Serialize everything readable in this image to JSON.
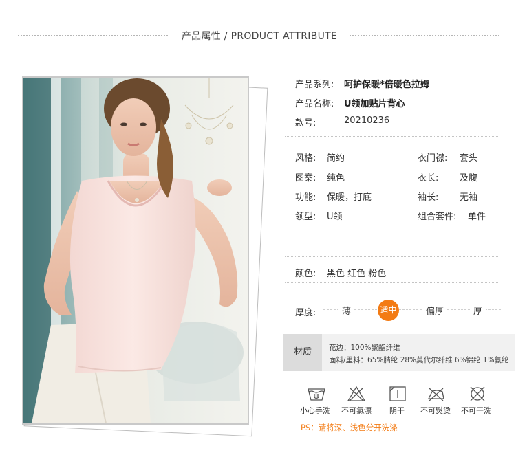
{
  "header": {
    "title": "产品属性 / PRODUCT ATTRIBUTE"
  },
  "basic": [
    {
      "label": "产品系列:",
      "value": "呵护保暖*倍暖色拉姆"
    },
    {
      "label": "产品名称:",
      "value": "U领加贴片背心"
    },
    {
      "label": "款号:",
      "value": "20210236"
    }
  ],
  "attrs_left": [
    {
      "label": "风格:",
      "value": "简约"
    },
    {
      "label": "图案:",
      "value": "纯色"
    },
    {
      "label": "功能:",
      "value": "保暖，打底"
    },
    {
      "label": "领型:",
      "value": "U领"
    }
  ],
  "attrs_right": [
    {
      "label": "衣门襟:",
      "value": "套头"
    },
    {
      "label": "衣长:",
      "value": "及腹"
    },
    {
      "label": "袖长:",
      "value": "无袖"
    },
    {
      "label": "组合套件:",
      "value": "单件"
    }
  ],
  "color": {
    "label": "颜色:",
    "value": "黑色  红色  粉色"
  },
  "thickness": {
    "label": "厚度:",
    "options": [
      "薄",
      "适中",
      "偏厚",
      "厚"
    ],
    "selected": "适中",
    "accent": "#f37b14"
  },
  "material": {
    "label": "材质",
    "lines": [
      "花边：100%聚酯纤维",
      "面料/里料：65%腈纶 28%莫代尔纤维 6%锦纶 1%氨纶"
    ]
  },
  "care": [
    {
      "icon": "hand-wash-icon",
      "label": "小心手洗"
    },
    {
      "icon": "no-bleach-icon",
      "label": "不可氯漂"
    },
    {
      "icon": "shade-dry-icon",
      "label": "阴干"
    },
    {
      "icon": "no-iron-icon",
      "label": "不可熨烫"
    },
    {
      "icon": "no-dry-clean-icon",
      "label": "不可干洗"
    }
  ],
  "care_note": "PS：请将深、浅色分开洗涤"
}
